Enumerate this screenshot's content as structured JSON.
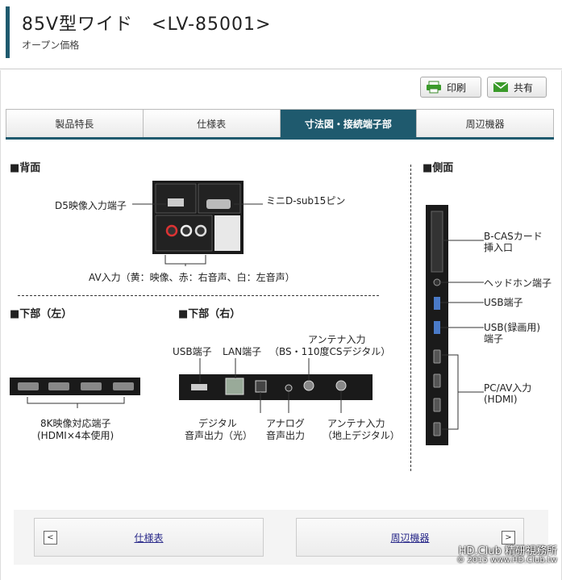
{
  "header": {
    "title": "85V型ワイド　<LV-85001>",
    "subtitle": "オープン価格"
  },
  "actions": {
    "print": "印刷",
    "share": "共有"
  },
  "tabs": [
    {
      "label": "製品特長"
    },
    {
      "label": "仕様表"
    },
    {
      "label": "寸法図・接続端子部"
    },
    {
      "label": "周辺機器"
    }
  ],
  "sections": {
    "back": "■背面",
    "side": "■側面",
    "bottom_left": "■下部（左）",
    "bottom_right": "■下部（右）"
  },
  "back_panel": {
    "d5": "D5映像入力端子",
    "minidsub": "ミニD-sub15ピン",
    "av": "AV入力（黄：映像、赤：右音声、白：左音声）"
  },
  "side_panel": {
    "bcas": [
      "B-CASカード",
      "挿入口"
    ],
    "headphone": "ヘッドホン端子",
    "usb": "USB端子",
    "usb_rec": [
      "USB(録画用)",
      "端子"
    ],
    "pcav": [
      "PC/AV入力",
      "(HDMI)"
    ]
  },
  "bottom_left": {
    "hdmi": [
      "8K映像対応端子",
      "(HDMI×4本使用)"
    ]
  },
  "bottom_right": {
    "usb": "USB端子",
    "lan": "LAN端子",
    "antenna_bs": [
      "アンテナ入力",
      "（BS・110度CSデジタル）"
    ],
    "digital_audio": [
      "デジタル",
      "音声出力（光）"
    ],
    "analog_audio": [
      "アナログ",
      "音声出力"
    ],
    "antenna_terrestrial": [
      "アンテナ入力",
      "（地上デジタル）"
    ]
  },
  "nav": {
    "prev": "仕様表",
    "next": "周辺機器",
    "prev_arrow": "<",
    "next_arrow": ">"
  },
  "watermark": {
    "line1": "HD.Club 精研視務所",
    "line2": "© 2015  www.HD.Club.tw"
  },
  "colors": {
    "accent": "#1f5a6e"
  }
}
